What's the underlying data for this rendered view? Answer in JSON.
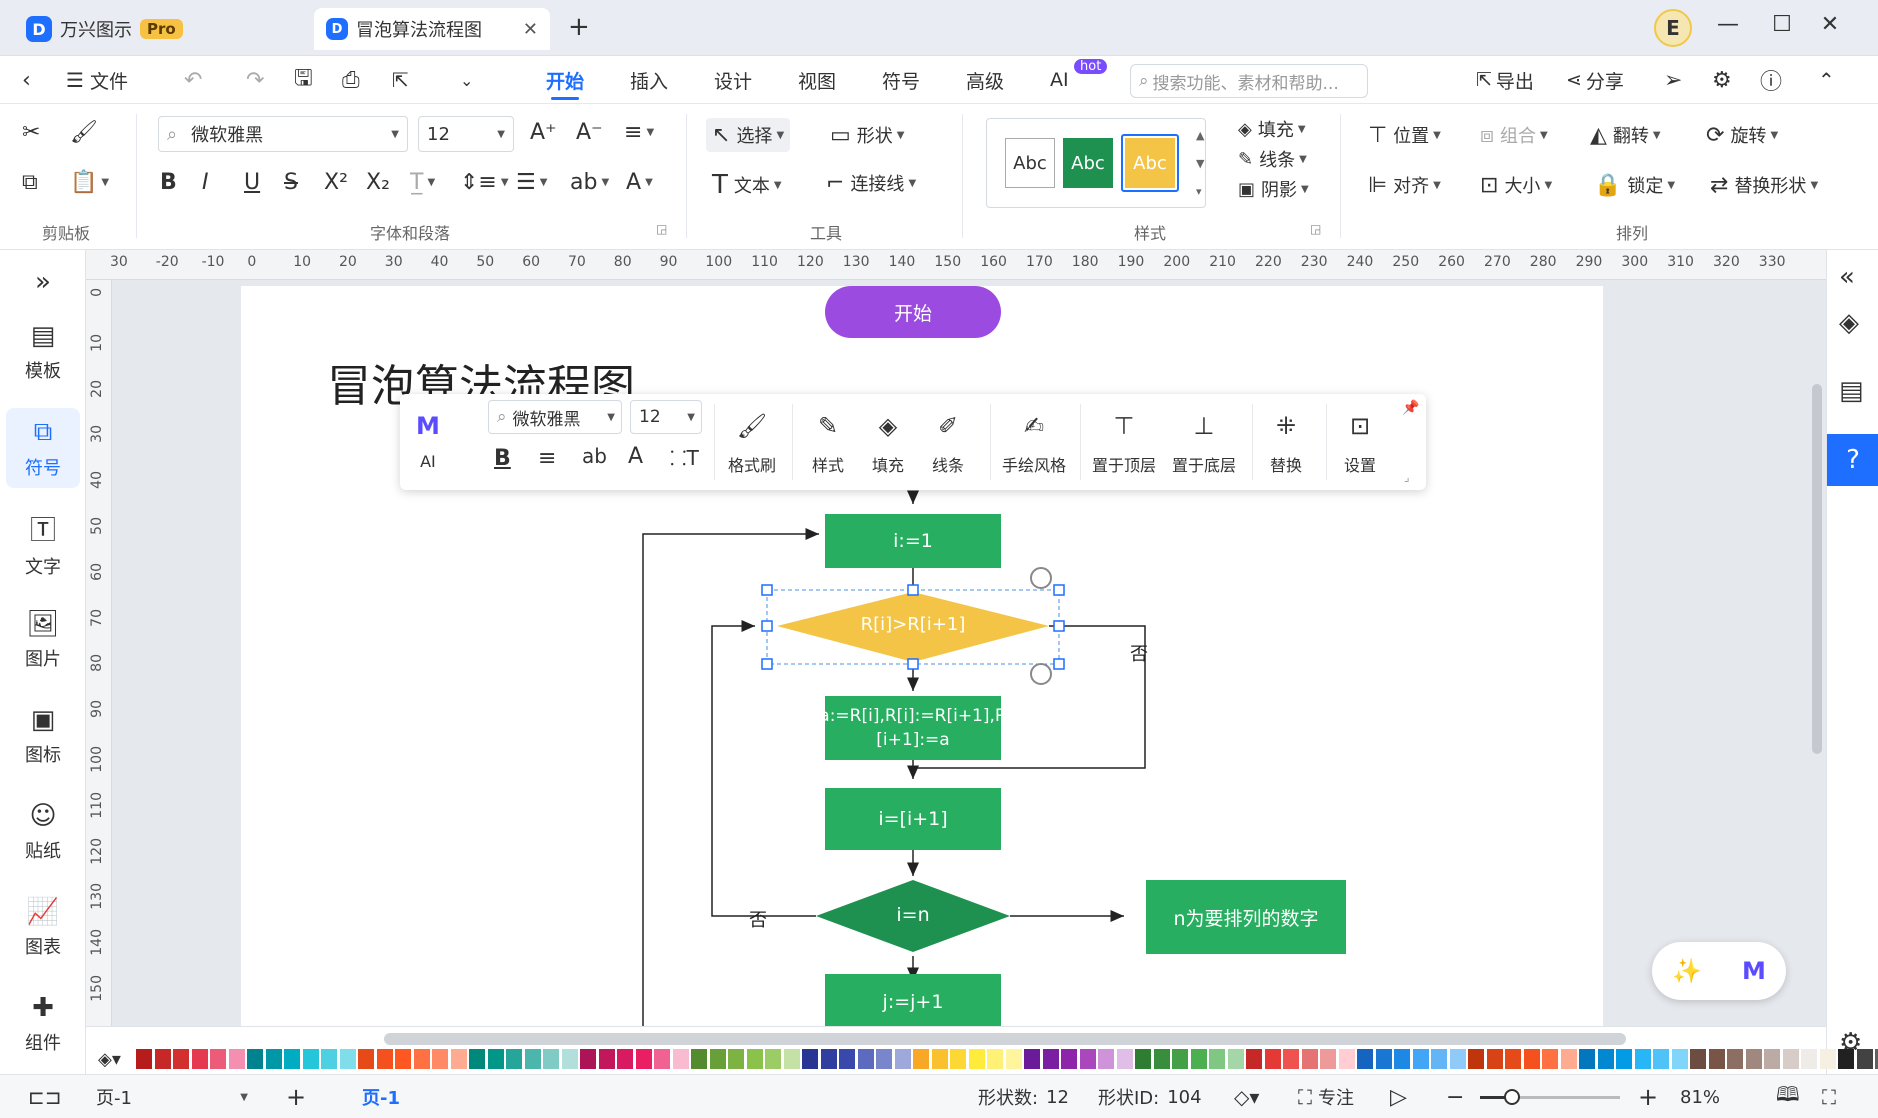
{
  "app": {
    "name": "万兴图示",
    "badge": "Pro",
    "logo": "D"
  },
  "tabs": [
    {
      "label": "冒泡算法流程图"
    }
  ],
  "window": {
    "user_initial": "E"
  },
  "menubar": {
    "file": "文件",
    "items": [
      "开始",
      "插入",
      "设计",
      "视图",
      "符号",
      "高级",
      "AI"
    ],
    "hot": "hot",
    "search_placeholder": "搜索功能、素材和帮助...",
    "export": "导出",
    "share": "分享"
  },
  "ribbon": {
    "font": "微软雅黑",
    "size": "12",
    "groups": {
      "clipboard": "剪贴板",
      "font": "字体和段落",
      "tools": "工具",
      "style": "样式",
      "arrange": "排列"
    },
    "tools": {
      "select": "选择",
      "shape": "形状",
      "text": "文本",
      "connector": "连接线"
    },
    "styles": [
      "Abc",
      "Abc",
      "Abc"
    ],
    "style_opts": {
      "fill": "填充",
      "line": "线条",
      "shadow": "阴影"
    },
    "arrange": {
      "position": "位置",
      "group": "组合",
      "flip": "翻转",
      "rotate": "旋转",
      "align": "对齐",
      "size": "大小",
      "lock": "锁定",
      "replace": "替换形状"
    }
  },
  "leftbar": [
    {
      "label": "模板",
      "icon": "template-icon"
    },
    {
      "label": "符号",
      "icon": "symbol-icon"
    },
    {
      "label": "文字",
      "icon": "text-icon"
    },
    {
      "label": "图片",
      "icon": "image-icon"
    },
    {
      "label": "图标",
      "icon": "icon-icon"
    },
    {
      "label": "贴纸",
      "icon": "sticker-icon"
    },
    {
      "label": "图表",
      "icon": "chart-icon"
    },
    {
      "label": "组件",
      "icon": "component-icon"
    }
  ],
  "ruler": {
    "h": [
      "30",
      "-20",
      "-10",
      "0",
      "10",
      "20",
      "30",
      "40",
      "50",
      "60",
      "70",
      "80",
      "90",
      "100",
      "110",
      "120",
      "130",
      "140",
      "150",
      "160",
      "170",
      "180",
      "190",
      "200",
      "210",
      "220",
      "230",
      "240",
      "250",
      "260",
      "270",
      "280",
      "290",
      "300",
      "310",
      "320",
      "330"
    ],
    "v": [
      "0",
      "10",
      "20",
      "30",
      "40",
      "50",
      "60",
      "70",
      "80",
      "90",
      "100",
      "110",
      "120",
      "130",
      "140",
      "150"
    ]
  },
  "diagram": {
    "title": "冒泡算法流程图",
    "start": "开始",
    "init": "i:=1",
    "cond1": "R[i]>R[i+1]",
    "no1": "否",
    "swap1": "a:=R[i],R[i]:=R[i+1],R",
    "swap2": "[i+1]:=a",
    "inc": "i=[i+1]",
    "cond2": "i=n",
    "no2": "否",
    "note": "n为要排列的数字",
    "jinc": "j:=j+1"
  },
  "float_toolbar": {
    "ai": "AI",
    "font": "微软雅黑",
    "size": "12",
    "format_painter": "格式刷",
    "style": "样式",
    "fill": "填充",
    "line": "线条",
    "sketch": "手绘风格",
    "top": "置于顶层",
    "bottom": "置于底层",
    "replace": "替换",
    "settings": "设置"
  },
  "status": {
    "page_select": "页-1",
    "page_tab": "页-1",
    "shapes_label": "形状数:",
    "shapes": "12",
    "id_label": "形状ID:",
    "id": "104",
    "focus": "专注",
    "zoom": "81%"
  },
  "colors": {
    "accent": "#1e6fff",
    "green": "#27ae60",
    "dark_green": "#1e9150",
    "yellow": "#f3c445",
    "purple": "#9b4be0"
  },
  "palette": [
    "#b71c1c",
    "#c62828",
    "#d32f2f",
    "#e53950",
    "#ec5c78",
    "#f48fb1",
    "#00838f",
    "#0097a7",
    "#00acc1",
    "#26c6da",
    "#4dd0e1",
    "#80deea",
    "#e64a19",
    "#f4511e",
    "#ff5722",
    "#ff7043",
    "#ff8a65",
    "#ffab91",
    "#00897b",
    "#009688",
    "#26a69a",
    "#4db6ac",
    "#80cbc4",
    "#b2dfdb",
    "#ad1457",
    "#c2185b",
    "#d81b60",
    "#e91e63",
    "#f06292",
    "#f8bbd0",
    "#558b2f",
    "#689f38",
    "#7cb342",
    "#8bc34a",
    "#9ccc65",
    "#c5e1a5",
    "#283593",
    "#303f9f",
    "#3949ab",
    "#5c6bc0",
    "#7986cb",
    "#9fa8da",
    "#f9a825",
    "#fbc02d",
    "#fdd835",
    "#ffeb3b",
    "#fff176",
    "#fff59d",
    "#6a1b9a",
    "#7b1fa2",
    "#8e24aa",
    "#ab47bc",
    "#ce93d8",
    "#e1bee7",
    "#2e7d32",
    "#388e3c",
    "#43a047",
    "#4caf50",
    "#81c784",
    "#a5d6a7",
    "#c62828",
    "#e53935",
    "#ef5350",
    "#e57373",
    "#ef9a9a",
    "#ffcdd2",
    "#1565c0",
    "#1976d2",
    "#1e88e5",
    "#42a5f5",
    "#64b5f6",
    "#90caf9",
    "#bf360c",
    "#d84315",
    "#e64a19",
    "#f4511e",
    "#ff7043",
    "#ffab91",
    "#0277bd",
    "#0288d1",
    "#039be5",
    "#29b6f6",
    "#4fc3f7",
    "#81d4fa",
    "#6d4c41",
    "#795548",
    "#8d6e63",
    "#a1887f",
    "#bcaaa4",
    "#d7ccc8",
    "#efebe9",
    "#f5f0e1",
    "#212121",
    "#424242",
    "#616161",
    "#757575",
    "#9e9e9e",
    "#bdbdbd",
    "#e0e0e0"
  ]
}
